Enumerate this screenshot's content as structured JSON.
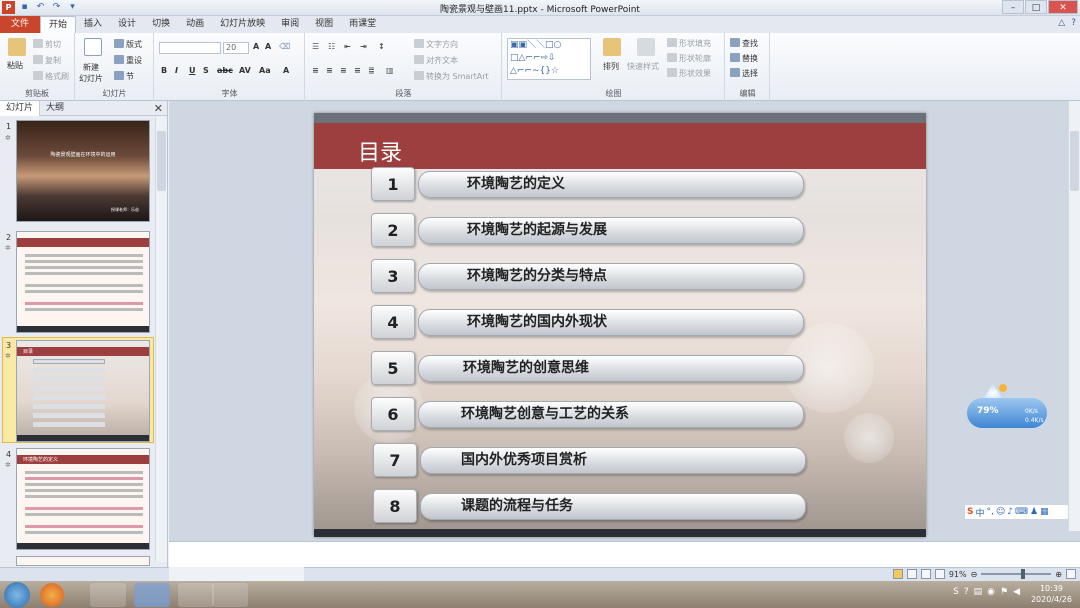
{
  "window": {
    "title": "陶瓷景观与壁画11.pptx - Microsoft PowerPoint"
  },
  "qat": {
    "icons": [
      "P",
      "▪",
      "↶",
      "↷",
      "▾"
    ]
  },
  "tabs": [
    "文件",
    "开始",
    "插入",
    "设计",
    "切换",
    "动画",
    "幻灯片放映",
    "审阅",
    "视图",
    "雨课堂"
  ],
  "ribbon": {
    "clipboard": {
      "paste": "粘贴",
      "cut": "剪切",
      "copy": "复制",
      "format_painter": "格式刷",
      "label": "剪贴板"
    },
    "slides": {
      "new_slide_1": "新建",
      "new_slide_2": "幻灯片",
      "layout": "版式",
      "reset": "重设",
      "section": "节",
      "label": "幻灯片"
    },
    "font": {
      "size": "20",
      "label": "字体"
    },
    "paragraph": {
      "text_direction": "文字方向",
      "align_text": "对齐文本",
      "smartart": "转换为 SmartArt",
      "label": "段落"
    },
    "drawing": {
      "arrange": "排列",
      "quick_styles": "快速样式",
      "shape_fill": "形状填充",
      "shape_outline": "形状轮廓",
      "shape_effects": "形状效果",
      "label": "绘图"
    },
    "editing": {
      "find": "查找",
      "replace": "替换",
      "select": "选择",
      "label": "编辑"
    }
  },
  "panel": {
    "tab_slides": "幻灯片",
    "tab_outline": "大纲"
  },
  "thumbs": [
    {
      "num": "1",
      "title": "陶瓷景观壁画在环境中的运用",
      "author": "授课老师：乐苗"
    },
    {
      "num": "2"
    },
    {
      "num": "3",
      "title": "目录"
    },
    {
      "num": "4",
      "title": "环境陶艺的定义"
    }
  ],
  "slide": {
    "title": "目录",
    "items": [
      {
        "num": "1",
        "text": "环境陶艺的定义"
      },
      {
        "num": "2",
        "text": "环境陶艺的起源与发展"
      },
      {
        "num": "3",
        "text": "环境陶艺的分类与特点"
      },
      {
        "num": "4",
        "text": "环境陶艺的国内外现状"
      },
      {
        "num": "5",
        "text": "环境陶艺的创意思维"
      },
      {
        "num": "6",
        "text": "环境陶艺创意与工艺的关系"
      },
      {
        "num": "7",
        "text": "国内外优秀项目赏析"
      },
      {
        "num": "8",
        "text": "课题的流程与任务"
      }
    ]
  },
  "widget": {
    "mem": "79%",
    "net_up": "0K/s",
    "net_down": "0.4K/s"
  },
  "ime": {
    "logo": "S",
    "mode": "中"
  },
  "status": {
    "zoom": "91%"
  },
  "clock": {
    "time": "10:39",
    "date": "2020/4/26"
  }
}
